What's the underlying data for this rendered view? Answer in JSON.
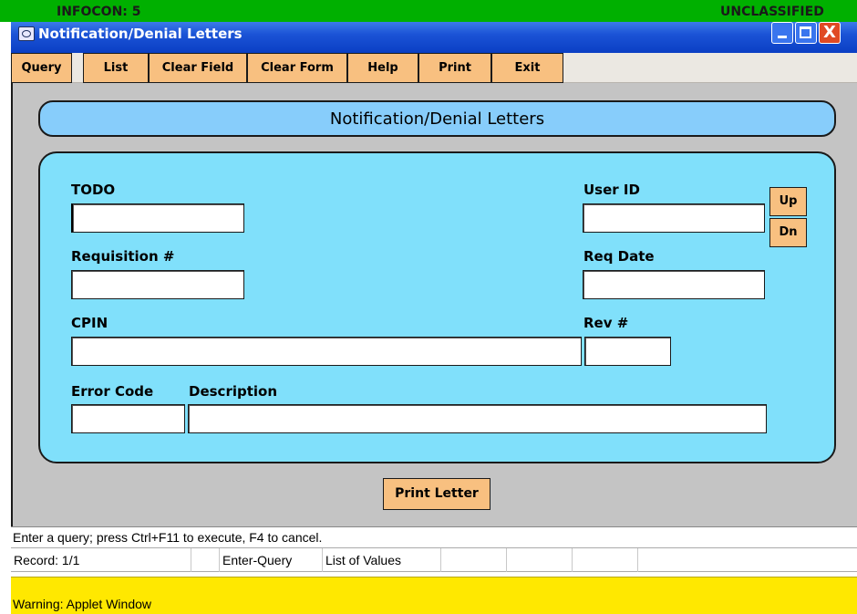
{
  "banner": {
    "left_text": "INFOCON: 5",
    "right_text": "UNCLASSIFIED",
    "color": "#00b000"
  },
  "window": {
    "title": "Notification/Denial Letters",
    "close_glyph": "X"
  },
  "toolbar": {
    "buttons": [
      "Query",
      "List",
      "Clear Field",
      "Clear Form",
      "Help",
      "Print",
      "Exit"
    ]
  },
  "form": {
    "header": "Notification/Denial Letters",
    "labels": {
      "todo": "TODO",
      "user_id": "User ID",
      "requisition": "Requisition #",
      "req_date": "Req Date",
      "cpin": "CPIN",
      "rev": "Rev #",
      "error_code": "Error Code",
      "description": "Description"
    },
    "values": {
      "todo": "",
      "user_id": "",
      "requisition": "",
      "req_date": "",
      "cpin": "",
      "rev": "",
      "error_code": "",
      "description": ""
    },
    "up_label": "Up",
    "dn_label": "Dn",
    "print_letter_label": "Print Letter"
  },
  "status": {
    "hint": "Enter a query;  press Ctrl+F11 to execute, F4 to cancel.",
    "record": "Record: 1/1",
    "mode": "Enter-Query",
    "lov": "List of Values"
  },
  "warning": {
    "text": "Warning: Applet Window"
  },
  "colors": {
    "accent_button": "#f8c080",
    "panel": "#80e0fb",
    "header_pill": "#87cdfb",
    "titlebar": "#1b53d6",
    "warning": "#ffe800"
  }
}
